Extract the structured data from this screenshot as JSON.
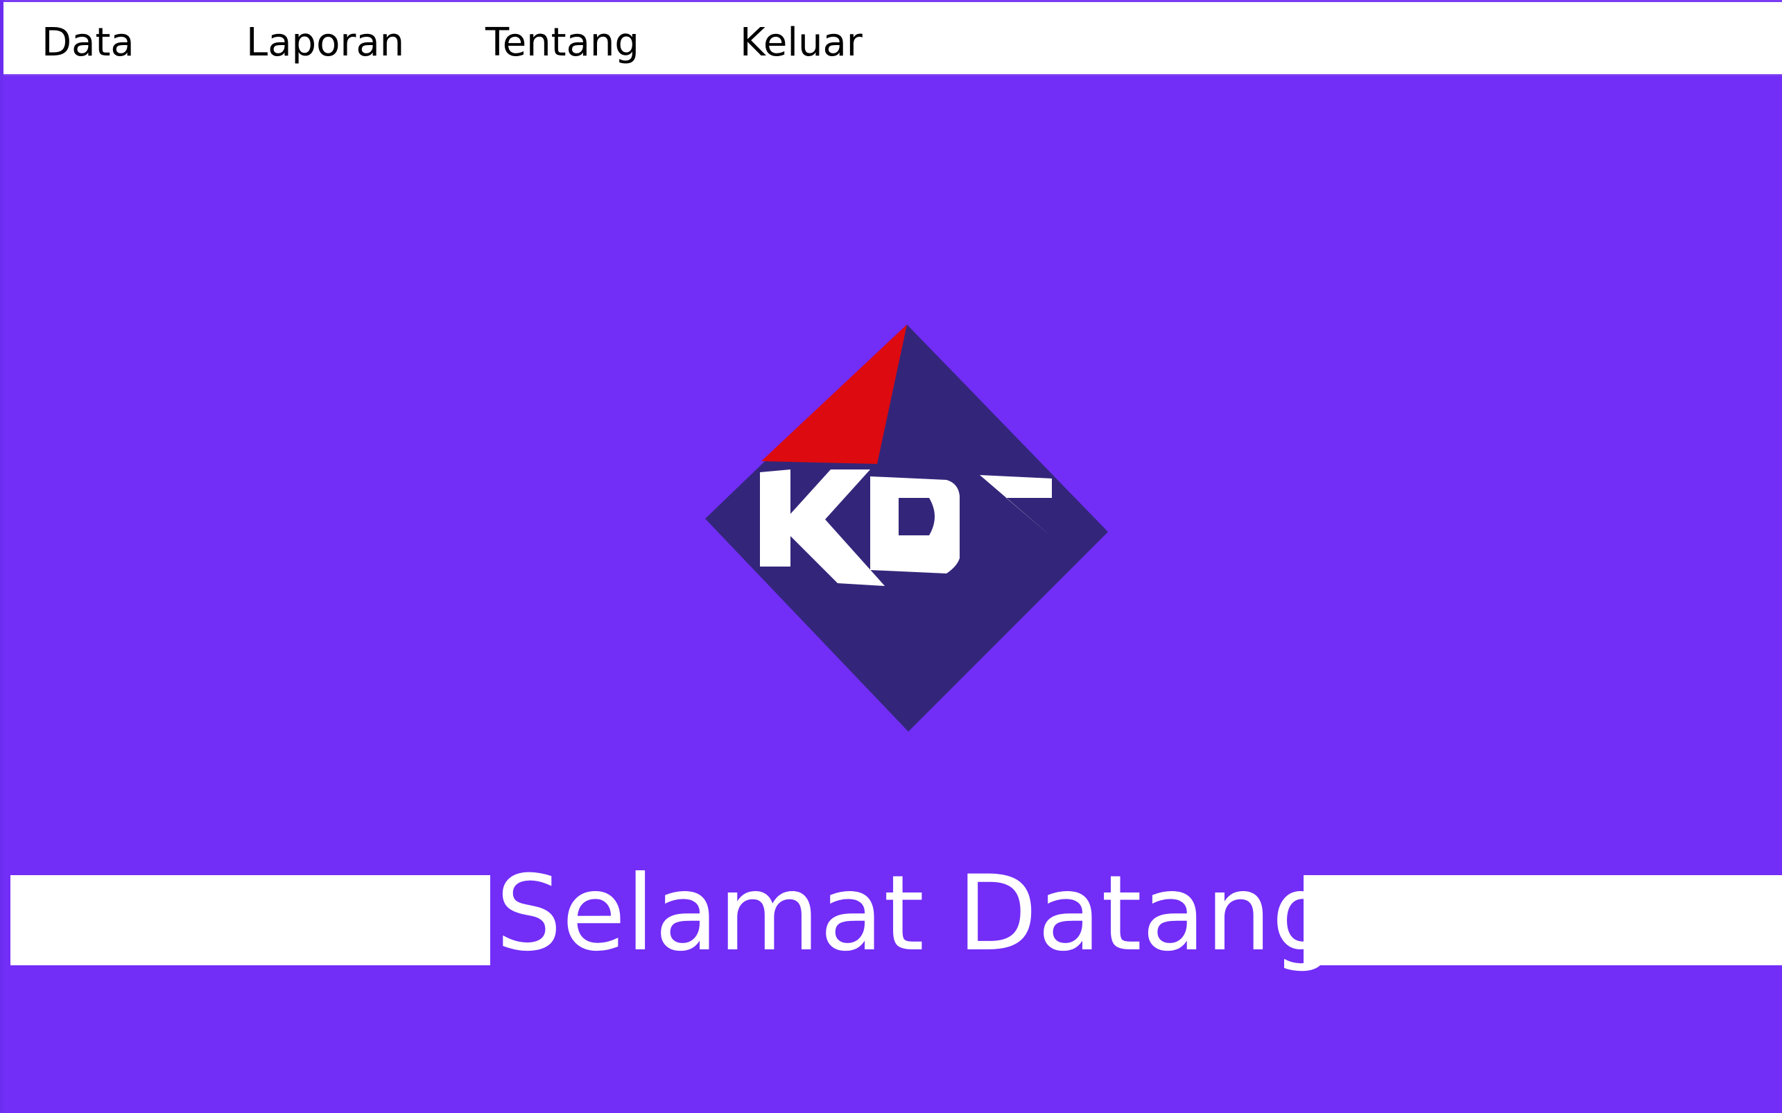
{
  "menu": {
    "items": [
      {
        "label": "Data"
      },
      {
        "label": "Laporan"
      },
      {
        "label": "Tentang"
      },
      {
        "label": "Keluar"
      }
    ]
  },
  "logo": {
    "text": "KDS",
    "colors": {
      "diamond": "#33267a",
      "accent": "#dd0a10",
      "letters": "#ffffff"
    }
  },
  "welcome": {
    "text": "Selamat Datang"
  },
  "colors": {
    "background": "#722df7",
    "menubar": "#ffffff",
    "welcome_bars": "#ffffff"
  }
}
